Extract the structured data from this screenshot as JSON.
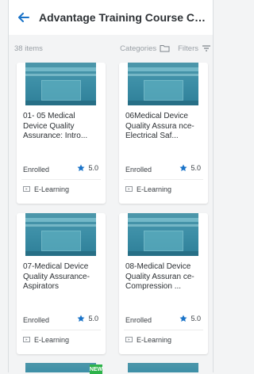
{
  "header": {
    "title": "Advantage Training Course Catalog",
    "back_icon": "arrow-left-icon"
  },
  "toolbar": {
    "count_label": "38 items",
    "categories_label": "Categories",
    "categories_icon": "folder-icon",
    "filters_label": "Filters",
    "filters_icon": "filter-icon"
  },
  "colors": {
    "accent": "#1a73c8",
    "badge": "#2db34a"
  },
  "courses": [
    {
      "title": "01- 05 Medical Device Quality Assurance: Intro...",
      "status": "Enrolled",
      "rating": "5.0",
      "type": "E-Learning"
    },
    {
      "title": "06Medical Device Quality Assura nce-Electrical Saf...",
      "status": "Enrolled",
      "rating": "5.0",
      "type": "E-Learning"
    },
    {
      "title": "07-Medical Device Quality Assurance-Aspirators",
      "status": "Enrolled",
      "rating": "5.0",
      "type": "E-Learning"
    },
    {
      "title": "08-Medical Device Quality Assuran ce-Compression ...",
      "status": "Enrolled",
      "rating": "5.0",
      "type": "E-Learning"
    }
  ],
  "peek_badge": "NEW"
}
